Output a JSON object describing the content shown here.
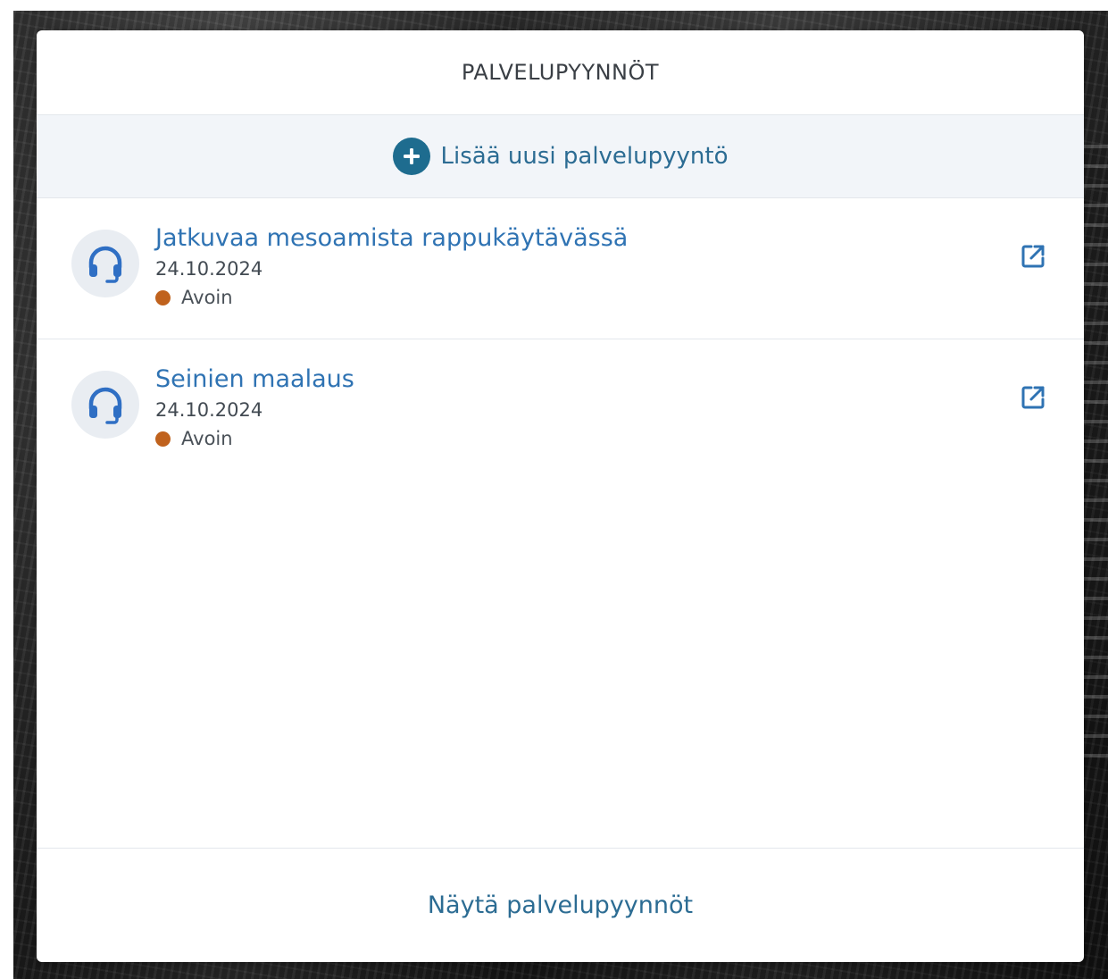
{
  "panel": {
    "title": "PALVELUPYYNNÖT",
    "add_label": "Lisää uusi palvelupyyntö",
    "add_icon": "plus-circle-icon",
    "footer_link": "Näytä palvelupyynnöt"
  },
  "requests": [
    {
      "title": "Jatkuvaa mesoamista rappukäytävässä",
      "date": "24.10.2024",
      "status": "Avoin",
      "icon": "headset-icon",
      "action_icon": "open-external-icon"
    },
    {
      "title": "Seinien maalaus",
      "date": "24.10.2024",
      "status": "Avoin",
      "icon": "headset-icon",
      "action_icon": "open-external-icon"
    }
  ],
  "colors": {
    "accent": "#2f73b3",
    "add_icon_bg": "#1e6c8f",
    "status_open": "#c0621d",
    "add_row_bg": "#f2f5f9"
  }
}
